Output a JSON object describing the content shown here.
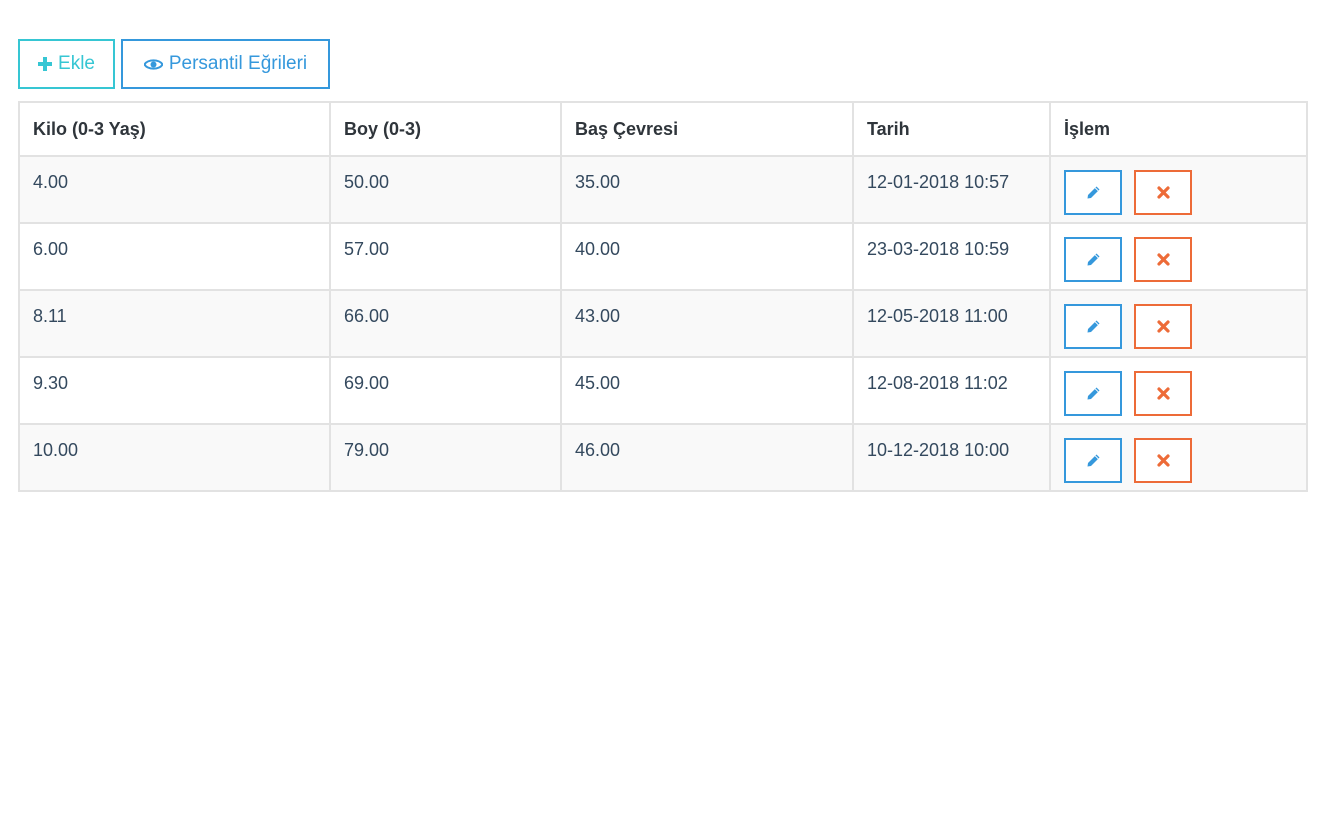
{
  "toolbar": {
    "add_label": "Ekle",
    "curves_label": "Persantil Eğrileri",
    "add_icon": "plus-icon",
    "curves_icon": "eye-icon"
  },
  "table": {
    "headers": {
      "weight": "Kilo (0-3 Yaş)",
      "height": "Boy (0-3)",
      "head": "Baş Çevresi",
      "date": "Tarih",
      "action": "İşlem"
    },
    "rows": [
      {
        "weight": "4.00",
        "height": "50.00",
        "head": "35.00",
        "date": "12-01-2018 10:57"
      },
      {
        "weight": "6.00",
        "height": "57.00",
        "head": "40.00",
        "date": "23-03-2018 10:59"
      },
      {
        "weight": "8.11",
        "height": "66.00",
        "head": "43.00",
        "date": "12-05-2018 11:00"
      },
      {
        "weight": "9.30",
        "height": "69.00",
        "head": "45.00",
        "date": "12-08-2018 11:02"
      },
      {
        "weight": "10.00",
        "height": "79.00",
        "head": "46.00",
        "date": "10-12-2018 10:00"
      }
    ],
    "edit_icon": "pencil-icon",
    "delete_icon": "times-icon"
  },
  "colors": {
    "add": "#36c6d3",
    "primary": "#3598dc",
    "danger": "#ed6b38"
  }
}
